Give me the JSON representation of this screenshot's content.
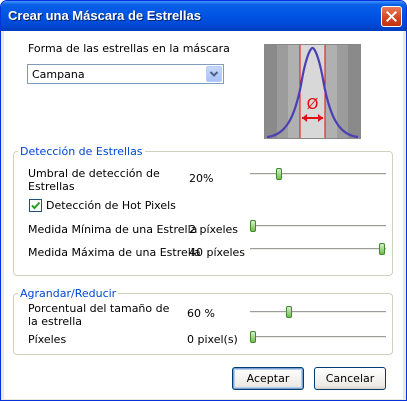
{
  "window": {
    "title": "Crear una Máscara de Estrellas"
  },
  "shape": {
    "label": "Forma de las estrellas en la máscara",
    "selected": "Campana"
  },
  "detection": {
    "group_title": "Detección de Estrellas",
    "threshold_label": "Umbral de detección de Estrellas",
    "threshold_value": "20%",
    "threshold_level": 0.2,
    "hot_pixels_label": "Detección de Hot Pixels",
    "hot_pixels_checked": true,
    "min_size_label": "Medida Mínima de una Estrella",
    "min_size_value": "2 píxeles",
    "min_size_level": 0.0,
    "max_size_label": "Medida Máxima de una Estrella",
    "max_size_value": "40 píxeles",
    "max_size_level": 1.0
  },
  "resize": {
    "group_title": "Agrandar/Reducir",
    "percent_label": "Porcentual del tamaño de la estrella",
    "percent_value": "60 %",
    "percent_level": 0.28,
    "pixels_label": "Píxeles",
    "pixels_value": "0 pixel(s)",
    "pixels_level": 0.0
  },
  "buttons": {
    "ok": "Aceptar",
    "cancel": "Cancelar"
  },
  "preview": {
    "diameter_symbol": "Ø",
    "curve_color": "#4a3fb5",
    "marker_color": "#e01010"
  },
  "colors": {
    "titlebar": "#0055e5",
    "group_title": "#0046d5"
  }
}
